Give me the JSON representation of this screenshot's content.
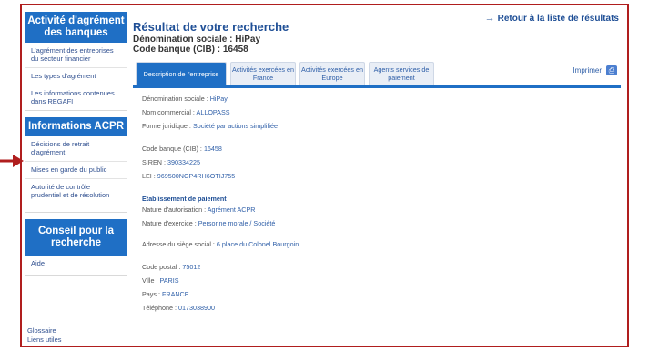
{
  "sidebar": {
    "section1_title": "Activité d'agrément des banques",
    "section1_items": [
      "L'agrément des entreprises du secteur financier",
      "Les types d'agrément",
      "Les informations contenues dans REGAFI"
    ],
    "section2_title": "Informations ACPR",
    "section2_items": [
      "Décisions de retrait d'agrément",
      "Mises en garde du public",
      "Autorité de contrôle prudentiel et de résolution"
    ],
    "section3_title": "Conseil pour la recherche",
    "section3_items": [
      "Aide"
    ],
    "footer_links": [
      "Glossaire",
      "Liens utiles"
    ]
  },
  "header": {
    "title": "Résultat de votre recherche",
    "denomination_label": "Dénomination sociale : HiPay",
    "code_label": "Code banque (CIB) : 16458",
    "back_link": "Retour à la liste de résultats"
  },
  "tabs": [
    "Description de l'entreprise",
    "Activités exercées en France",
    "Activités exercées en Europe",
    "Agents services de paiement"
  ],
  "print_label": "Imprimer",
  "details": {
    "rows1": [
      {
        "label": "Dénomination sociale :",
        "value": "HiPay"
      },
      {
        "label": "Nom commercial :",
        "value": "ALLOPASS"
      },
      {
        "label": "Forme juridique :",
        "value": "Société par actions simplifiée"
      }
    ],
    "rows2": [
      {
        "label": "Code banque (CIB) :",
        "value": "16458"
      },
      {
        "label": "SIREN :",
        "value": "390334225"
      },
      {
        "label": "LEI :",
        "value": "969500NGP4RH6OTIJ755"
      }
    ],
    "establishment_title": "Etablissement de paiement",
    "rows3": [
      {
        "label": "Nature d'autorisation :",
        "value": "Agrément ACPR"
      },
      {
        "label": "Nature d'exercice :",
        "value": "Personne morale / Société"
      }
    ],
    "address": {
      "label": "Adresse du siège social :",
      "value": "6 place du Colonel Bourgoin"
    },
    "rows4": [
      {
        "label": "Code postal :",
        "value": "75012"
      },
      {
        "label": "Ville :",
        "value": "PARIS"
      },
      {
        "label": "Pays :",
        "value": "FRANCE"
      },
      {
        "label": "Téléphone :",
        "value": "0173038900"
      }
    ]
  },
  "colors": {
    "accent": "#1f6fc5",
    "frame": "#b01e1e",
    "link": "#1f4f96"
  }
}
